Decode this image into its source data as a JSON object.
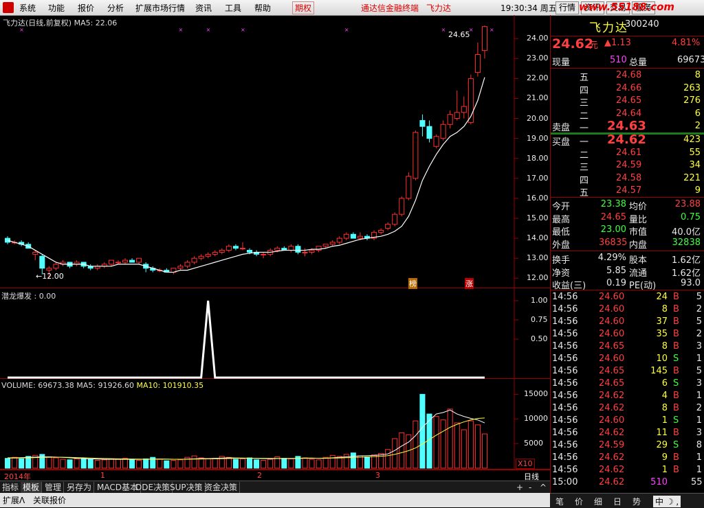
{
  "menubar": {
    "items": [
      "系统",
      "功能",
      "报价",
      "分析",
      "扩展市场行情",
      "资讯",
      "工具",
      "帮助"
    ],
    "futures": "期权",
    "title": "通达信金融终端",
    "stock_title": "飞力达",
    "clock": "19:30:34 周五",
    "tabs": [
      "行情",
      "资讯",
      "交易",
      "服务"
    ],
    "watermark": "www.55188.com"
  },
  "main_chart": {
    "header": "飞力达(日线,前复权) MA5: 22.06",
    "high_label": "24.65",
    "low_label": "12.00",
    "marks": [
      "榜",
      "涨"
    ],
    "y_ticks": [
      "24.00",
      "23.00",
      "22.00",
      "21.00",
      "20.00",
      "19.00",
      "18.00",
      "17.00",
      "16.00",
      "15.00",
      "14.00",
      "13.00",
      "12.00"
    ]
  },
  "indicator": {
    "header": "潜龙爆发 : 0.00",
    "y_ticks": [
      "1.00",
      "0.75",
      "0.50"
    ]
  },
  "volume": {
    "header_prefix": "VOLUME: 69673.38  MA5: 91926.60",
    "header_ma10": "MA10: 101910.35",
    "y_ticks": [
      "15000",
      "10000",
      "5000"
    ],
    "unit": "X10"
  },
  "x_axis": {
    "year": "2014年",
    "months": [
      "1",
      "2",
      "3"
    ],
    "period": "日线"
  },
  "bottom_tabs": [
    "指标",
    "模板",
    "管理",
    "另存为",
    "MACD基本",
    "DDE决策",
    "SUP决策",
    "资金决策"
  ],
  "bottom_bar": {
    "expand": "扩展Ʌ",
    "related": "关联报价"
  },
  "quote": {
    "name": "飞力达",
    "code": "300240",
    "price": "24.62",
    "price_unit": "元",
    "change": "▲1.13",
    "pct": "4.81%",
    "vol_label": "现量",
    "vol": "510",
    "total_label": "总量",
    "total": "69673",
    "sell_label": "卖盘",
    "buy_label": "买盘",
    "asks": [
      {
        "lvl": "五",
        "price": "24.68",
        "qty": "8"
      },
      {
        "lvl": "四",
        "price": "24.66",
        "qty": "263"
      },
      {
        "lvl": "三",
        "price": "24.65",
        "qty": "276"
      },
      {
        "lvl": "二",
        "price": "24.64",
        "qty": "6"
      },
      {
        "lvl": "一",
        "price": "24.63",
        "qty": "2"
      }
    ],
    "bids": [
      {
        "lvl": "一",
        "price": "24.62",
        "qty": "423"
      },
      {
        "lvl": "二",
        "price": "24.61",
        "qty": "55"
      },
      {
        "lvl": "三",
        "price": "24.59",
        "qty": "34"
      },
      {
        "lvl": "四",
        "price": "24.58",
        "qty": "221"
      },
      {
        "lvl": "五",
        "price": "24.57",
        "qty": "9"
      }
    ],
    "stats": [
      {
        "l1": "今开",
        "v1": "23.38",
        "c1": "grn",
        "l2": "均价",
        "v2": "23.88",
        "c2": "red"
      },
      {
        "l1": "最高",
        "v1": "24.65",
        "c1": "red",
        "l2": "量比",
        "v2": "0.75",
        "c2": "grn"
      },
      {
        "l1": "最低",
        "v1": "23.00",
        "c1": "grn",
        "l2": "市值",
        "v2": "40.0亿",
        "c2": "wht"
      },
      {
        "l1": "外盘",
        "v1": "36835",
        "c1": "red",
        "l2": "内盘",
        "v2": "32838",
        "c2": "grn"
      }
    ],
    "fund": [
      {
        "l1": "换手",
        "v1": "4.29%",
        "l2": "股本",
        "v2": "1.62亿"
      },
      {
        "l1": "净资",
        "v1": "5.85",
        "l2": "流通",
        "v2": "1.62亿"
      },
      {
        "l1": "收益(三)",
        "v1": "0.19",
        "l2": "PE(动)",
        "v2": "93.0"
      }
    ],
    "ticks": [
      {
        "t": "14:56",
        "p": "24.60",
        "v": "24",
        "s": "B",
        "n": "5"
      },
      {
        "t": "14:56",
        "p": "24.60",
        "v": "8",
        "s": "B",
        "n": "2"
      },
      {
        "t": "14:56",
        "p": "24.60",
        "v": "37",
        "s": "B",
        "n": "5"
      },
      {
        "t": "14:56",
        "p": "24.60",
        "v": "35",
        "s": "B",
        "n": "2"
      },
      {
        "t": "14:56",
        "p": "24.65",
        "v": "8",
        "s": "B",
        "n": "3"
      },
      {
        "t": "14:56",
        "p": "24.60",
        "v": "10",
        "s": "S",
        "n": "1"
      },
      {
        "t": "14:56",
        "p": "24.65",
        "v": "145",
        "s": "B",
        "n": "5"
      },
      {
        "t": "14:56",
        "p": "24.65",
        "v": "6",
        "s": "S",
        "n": "3"
      },
      {
        "t": "14:56",
        "p": "24.62",
        "v": "4",
        "s": "B",
        "n": "1"
      },
      {
        "t": "14:56",
        "p": "24.62",
        "v": "8",
        "s": "B",
        "n": "2"
      },
      {
        "t": "14:56",
        "p": "24.60",
        "v": "1",
        "s": "S",
        "n": "1"
      },
      {
        "t": "14:56",
        "p": "24.62",
        "v": "11",
        "s": "B",
        "n": "3"
      },
      {
        "t": "14:56",
        "p": "24.59",
        "v": "29",
        "s": "S",
        "n": "8"
      },
      {
        "t": "14:56",
        "p": "24.62",
        "v": "9",
        "s": "B",
        "n": "1"
      },
      {
        "t": "14:56",
        "p": "24.62",
        "v": "1",
        "s": "B",
        "n": "1"
      },
      {
        "t": "15:00",
        "p": "24.62",
        "v": "510",
        "s": "",
        "n": "55"
      }
    ],
    "panel_tabs": [
      "笔",
      "价",
      "细",
      "日",
      "势",
      "联"
    ]
  },
  "chart_data": {
    "type": "candlestick",
    "title": "飞力达(日线,前复权)",
    "ylim": [
      11.7,
      24.9
    ],
    "candles": [
      [
        14.0,
        14.1,
        13.7,
        13.8
      ],
      [
        13.8,
        13.9,
        13.7,
        13.8
      ],
      [
        13.8,
        13.9,
        13.6,
        13.7
      ],
      [
        13.7,
        13.8,
        13.5,
        13.5
      ],
      [
        13.2,
        13.4,
        12.9,
        13.3
      ],
      [
        13.1,
        13.2,
        12.2,
        12.5
      ],
      [
        12.4,
        12.6,
        12.0,
        12.5
      ],
      [
        12.5,
        12.8,
        12.4,
        12.7
      ],
      [
        12.7,
        12.9,
        12.6,
        12.8
      ],
      [
        12.8,
        12.8,
        12.5,
        12.6
      ],
      [
        12.7,
        12.9,
        12.6,
        12.8
      ],
      [
        12.8,
        12.8,
        12.5,
        12.6
      ],
      [
        12.6,
        12.7,
        12.4,
        12.5
      ],
      [
        12.5,
        12.7,
        12.4,
        12.6
      ],
      [
        12.6,
        12.8,
        12.5,
        12.7
      ],
      [
        12.7,
        12.9,
        12.6,
        12.9
      ],
      [
        12.8,
        12.9,
        12.7,
        12.8
      ],
      [
        12.8,
        13.0,
        12.7,
        12.9
      ],
      [
        12.9,
        13.0,
        12.8,
        12.8
      ],
      [
        12.8,
        13.0,
        12.7,
        13.0
      ],
      [
        12.7,
        12.8,
        12.3,
        12.5
      ],
      [
        12.5,
        12.6,
        12.3,
        12.4
      ],
      [
        12.4,
        12.5,
        12.3,
        12.4
      ],
      [
        12.4,
        12.5,
        12.3,
        12.3
      ],
      [
        12.3,
        12.5,
        12.2,
        12.5
      ],
      [
        12.5,
        12.7,
        12.4,
        12.6
      ],
      [
        12.6,
        12.9,
        12.5,
        12.8
      ],
      [
        12.8,
        13.1,
        12.7,
        13.0
      ],
      [
        13.0,
        13.2,
        12.9,
        13.1
      ],
      [
        13.1,
        13.3,
        13.0,
        13.2
      ],
      [
        13.2,
        13.4,
        13.1,
        13.3
      ],
      [
        13.3,
        13.5,
        13.2,
        13.4
      ],
      [
        13.4,
        13.7,
        13.3,
        13.6
      ],
      [
        13.6,
        13.7,
        13.4,
        13.5
      ],
      [
        13.5,
        13.8,
        13.4,
        13.5
      ],
      [
        13.4,
        13.5,
        13.2,
        13.3
      ],
      [
        13.3,
        13.4,
        13.1,
        13.2
      ],
      [
        13.2,
        13.3,
        13.0,
        13.2
      ],
      [
        13.2,
        13.5,
        13.1,
        13.4
      ],
      [
        13.4,
        13.6,
        13.3,
        13.5
      ],
      [
        13.5,
        13.6,
        13.4,
        13.4
      ],
      [
        13.4,
        13.7,
        13.3,
        13.6
      ],
      [
        13.6,
        13.7,
        13.2,
        13.3
      ],
      [
        13.3,
        13.5,
        13.1,
        13.3
      ],
      [
        13.3,
        13.5,
        13.2,
        13.4
      ],
      [
        13.4,
        13.6,
        13.3,
        13.6
      ],
      [
        13.6,
        13.7,
        13.5,
        13.7
      ],
      [
        13.7,
        13.9,
        13.6,
        13.8
      ],
      [
        13.8,
        14.1,
        13.7,
        14.0
      ],
      [
        14.0,
        14.3,
        13.9,
        14.2
      ],
      [
        14.2,
        14.3,
        14.0,
        14.0
      ],
      [
        14.0,
        14.3,
        13.9,
        14.1
      ],
      [
        14.1,
        14.2,
        13.9,
        14.0
      ],
      [
        14.0,
        14.4,
        13.9,
        14.3
      ],
      [
        14.3,
        14.5,
        14.2,
        14.4
      ],
      [
        14.5,
        14.8,
        14.4,
        14.7
      ],
      [
        14.7,
        15.3,
        14.6,
        15.2
      ],
      [
        15.2,
        16.1,
        15.1,
        16.0
      ],
      [
        16.0,
        17.3,
        15.9,
        17.1
      ],
      [
        17.0,
        19.4,
        16.9,
        19.3
      ],
      [
        19.9,
        20.2,
        19.1,
        19.6
      ],
      [
        19.6,
        19.9,
        18.8,
        19.0
      ],
      [
        18.6,
        19.2,
        18.5,
        19.1
      ],
      [
        19.0,
        19.9,
        18.9,
        19.7
      ],
      [
        19.7,
        20.4,
        19.5,
        20.2
      ],
      [
        20.0,
        21.4,
        19.9,
        20.3
      ],
      [
        20.3,
        21.1,
        20.0,
        20.6
      ],
      [
        19.8,
        22.2,
        19.7,
        22.0
      ],
      [
        22.3,
        23.8,
        22.1,
        23.2
      ],
      [
        23.4,
        24.65,
        23.0,
        24.6
      ]
    ],
    "ma5": [
      13.9,
      13.8,
      13.7,
      13.6,
      13.4,
      13.2,
      13.0,
      12.8,
      12.7,
      12.7,
      12.7,
      12.7,
      12.6,
      12.6,
      12.6,
      12.6,
      12.7,
      12.7,
      12.7,
      12.7,
      12.6,
      12.5,
      12.4,
      12.3,
      12.3,
      12.4,
      12.4,
      12.5,
      12.6,
      12.7,
      12.8,
      12.9,
      13.0,
      13.1,
      13.2,
      13.25,
      13.3,
      13.3,
      13.3,
      13.35,
      13.4,
      13.4,
      13.4,
      13.4,
      13.45,
      13.45,
      13.5,
      13.6,
      13.65,
      13.75,
      13.85,
      13.95,
      14.0,
      14.05,
      14.1,
      14.2,
      14.35,
      14.6,
      15.1,
      15.9,
      16.9,
      17.6,
      18.2,
      18.7,
      19.1,
      19.3,
      19.6,
      20.1,
      20.9,
      22.06
    ],
    "signal": [
      0,
      0,
      0,
      0,
      0,
      0,
      0,
      0,
      0,
      0,
      0,
      0,
      0,
      0,
      0,
      0,
      0,
      0,
      0,
      0,
      0,
      0,
      0,
      0,
      0,
      0,
      0,
      0,
      0,
      1,
      0,
      0,
      0,
      0,
      0,
      0,
      0,
      0,
      0,
      0,
      0,
      0,
      0,
      0,
      0,
      0,
      0,
      0,
      0,
      0,
      0,
      0,
      0,
      0,
      0,
      0,
      0,
      0,
      0,
      0,
      0,
      0,
      0,
      0,
      0,
      0,
      0,
      0,
      0,
      0
    ],
    "volume": [
      2000,
      2200,
      1900,
      2400,
      2600,
      2800,
      2300,
      2100,
      1800,
      1700,
      1900,
      2000,
      1800,
      1600,
      1700,
      1900,
      1800,
      2000,
      1700,
      1600,
      1900,
      2200,
      1800,
      1500,
      1600,
      1700,
      2200,
      2500,
      2100,
      1900,
      2000,
      2400,
      2200,
      1800,
      1900,
      2100,
      1700,
      1600,
      1800,
      2300,
      2000,
      1900,
      2400,
      2100,
      1800,
      1700,
      2200,
      2600,
      2400,
      2800,
      3100,
      2500,
      2300,
      2700,
      3000,
      3800,
      6000,
      7200,
      6800,
      9600,
      15000,
      11000,
      10500,
      9800,
      12000,
      9200,
      7800,
      9600,
      8800,
      6960
    ],
    "vol_ma5": [
      2100,
      2100,
      2150,
      2200,
      2250,
      2300,
      2300,
      2250,
      2200,
      2100,
      2000,
      1950,
      1900,
      1850,
      1800,
      1800,
      1800,
      1800,
      1800,
      1800,
      1820,
      1850,
      1860,
      1840,
      1820,
      1800,
      1850,
      1900,
      1950,
      1950,
      2000,
      2050,
      2100,
      2080,
      2050,
      2020,
      1990,
      1950,
      1920,
      1950,
      1950,
      1950,
      2000,
      2050,
      2050,
      2000,
      2000,
      2100,
      2200,
      2300,
      2400,
      2500,
      2550,
      2600,
      2700,
      2900,
      3600,
      4500,
      5300,
      6600,
      8300,
      9700,
      11000,
      11300,
      11800,
      11000,
      10500,
      10100,
      9800,
      9193
    ],
    "vol_ma10": [
      2050,
      2060,
      2080,
      2100,
      2150,
      2200,
      2220,
      2230,
      2220,
      2200,
      2150,
      2100,
      2050,
      2000,
      1960,
      1930,
      1900,
      1880,
      1860,
      1840,
      1830,
      1830,
      1830,
      1830,
      1820,
      1820,
      1830,
      1850,
      1870,
      1890,
      1910,
      1940,
      1970,
      2000,
      2010,
      2010,
      2010,
      2000,
      1990,
      1980,
      1980,
      1980,
      1990,
      2000,
      2010,
      2020,
      2030,
      2050,
      2080,
      2120,
      2170,
      2230,
      2290,
      2350,
      2420,
      2550,
      2800,
      3150,
      3550,
      4100,
      4900,
      5800,
      6700,
      7500,
      8300,
      8900,
      9400,
      9800,
      10100,
      10191
    ],
    "volume_ylim": [
      0,
      17000
    ]
  }
}
